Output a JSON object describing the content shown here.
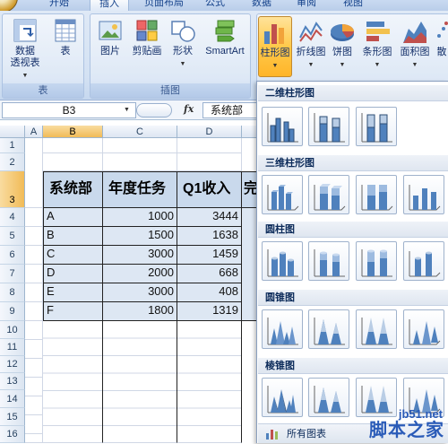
{
  "tabs": [
    {
      "label": "开始"
    },
    {
      "label": "插入"
    },
    {
      "label": "页面布局"
    },
    {
      "label": "公式"
    },
    {
      "label": "数据"
    },
    {
      "label": "审阅"
    },
    {
      "label": "视图"
    }
  ],
  "ribbon": {
    "table_group": {
      "label": "表",
      "pivot_line1": "数据",
      "pivot_line2": "透视表",
      "table": "表"
    },
    "illustrations_group": {
      "label": "插图",
      "picture": "图片",
      "clipart": "剪贴画",
      "shapes": "形状",
      "smartart": "SmartArt"
    },
    "chart_buttons": [
      {
        "label": "柱形图",
        "icon": "column-chart-icon"
      },
      {
        "label": "折线图",
        "icon": "line-chart-icon"
      },
      {
        "label": "饼图",
        "icon": "pie-chart-icon"
      },
      {
        "label": "条形图",
        "icon": "bar-chart-icon"
      },
      {
        "label": "面积图",
        "icon": "area-chart-icon"
      },
      {
        "label": "散",
        "icon": "scatter-chart-icon"
      }
    ]
  },
  "formula_bar": {
    "name_box": "B3",
    "fx": "fx",
    "content": "系统部"
  },
  "sheet": {
    "columns": [
      "A",
      "B",
      "C",
      "D"
    ],
    "rows": [
      "1",
      "2",
      "3",
      "4",
      "5",
      "6",
      "7",
      "8",
      "9",
      "10",
      "11",
      "12",
      "13",
      "14",
      "15",
      "16"
    ],
    "headers": [
      "系统部",
      "年度任务",
      "Q1收入",
      "完"
    ],
    "data": [
      [
        "A",
        "1000",
        "3444"
      ],
      [
        "B",
        "1500",
        "1638"
      ],
      [
        "C",
        "3000",
        "1459"
      ],
      [
        "D",
        "2000",
        "668"
      ],
      [
        "E",
        "3000",
        "408"
      ],
      [
        "F",
        "1800",
        "1319"
      ]
    ]
  },
  "gallery": {
    "sections": [
      {
        "title": "二维柱形图"
      },
      {
        "title": "三维柱形图"
      },
      {
        "title": "圆柱图"
      },
      {
        "title": "圆锥图"
      },
      {
        "title": "棱锥图"
      }
    ],
    "footer": "所有图表"
  },
  "watermark": {
    "url": "jb51.net",
    "name": "脚本之家"
  },
  "colors": {
    "accent": "#f5b536",
    "ribbon": "#d3e1f3",
    "header_fill": "#c9d9ec",
    "data_fill": "#dde7f3",
    "chart_blue": "#4f81bd"
  }
}
